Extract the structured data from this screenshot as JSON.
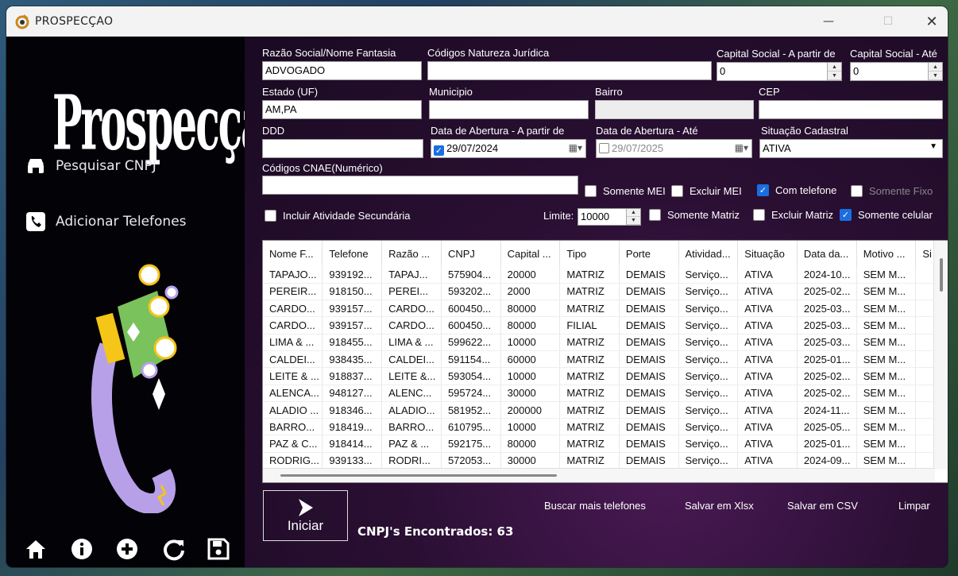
{
  "window": {
    "title": "PROSPECÇAO"
  },
  "sidebar": {
    "logo": "Prospecçao",
    "nav": [
      {
        "label": "Pesquisar CNPJ",
        "icon": "store-icon"
      },
      {
        "label": "Adicionar Telefones",
        "icon": "phone-icon"
      }
    ],
    "bottom_icons": [
      "home-icon",
      "info-icon",
      "add-icon",
      "refresh-icon",
      "save-icon"
    ]
  },
  "form": {
    "razao_label": "Razão Social/Nome Fantasia",
    "razao_value": "ADVOGADO",
    "natureza_label": "Códigos Natureza Jurídica",
    "natureza_value": "",
    "capital_de_label": "Capital Social - A partir de",
    "capital_de_value": "0",
    "capital_ate_label": "Capital Social - Até",
    "capital_ate_value": "0",
    "estado_label": "Estado (UF)",
    "estado_value": "AM,PA",
    "municipio_label": "Municipio",
    "municipio_value": "",
    "bairro_label": "Bairro",
    "bairro_value": "",
    "cep_label": "CEP",
    "cep_value": "",
    "ddd_label": "DDD",
    "ddd_value": "",
    "abertura_de_label": "Data de Abertura - A partir de",
    "abertura_de_value": "29/07/2024",
    "abertura_ate_label": "Data de Abertura - Até",
    "abertura_ate_value": "29/07/2025",
    "situacao_label": "Situação Cadastral",
    "situacao_value": "ATIVA",
    "cnae_label": "Códigos CNAE(Numérico)",
    "cnae_value": "",
    "somente_mei": "Somente MEI",
    "excluir_mei": "Excluir MEI",
    "com_telefone": "Com telefone",
    "somente_fixo": "Somente Fixo",
    "incluir_secundaria": "Incluir Atividade Secundária",
    "limite_label": "Limite:",
    "limite_value": "10000",
    "somente_matriz": "Somente Matriz",
    "excluir_matriz": "Excluir Matriz",
    "somente_celular": "Somente celular"
  },
  "table": {
    "columns": [
      "Nome F...",
      "Telefone",
      "Razão ...",
      "CNPJ",
      "Capital ...",
      "Tipo",
      "Porte",
      "Atividad...",
      "Situação",
      "Data da...",
      "Motivo ...",
      "Si"
    ],
    "rows": [
      [
        "TAPAJO...",
        "939192...",
        "TAPAJ...",
        "575904...",
        "20000",
        "MATRIZ",
        "DEMAIS",
        "Serviço...",
        "ATIVA",
        "2024-10...",
        "SEM M...",
        ""
      ],
      [
        "PEREIR...",
        "918150...",
        "PEREI...",
        "593202...",
        "2000",
        "MATRIZ",
        "DEMAIS",
        "Serviço...",
        "ATIVA",
        "2025-02...",
        "SEM M...",
        ""
      ],
      [
        "CARDO...",
        "939157...",
        "CARDO...",
        "600450...",
        "80000",
        "MATRIZ",
        "DEMAIS",
        "Serviço...",
        "ATIVA",
        "2025-03...",
        "SEM M...",
        ""
      ],
      [
        "CARDO...",
        "939157...",
        "CARDO...",
        "600450...",
        "80000",
        "FILIAL",
        "DEMAIS",
        "Serviço...",
        "ATIVA",
        "2025-03...",
        "SEM M...",
        ""
      ],
      [
        "LIMA & ...",
        "918455...",
        "LIMA & ...",
        "599622...",
        "10000",
        "MATRIZ",
        "DEMAIS",
        "Serviço...",
        "ATIVA",
        "2025-03...",
        "SEM M...",
        ""
      ],
      [
        "CALDEI...",
        "938435...",
        "CALDEI...",
        "591154...",
        "60000",
        "MATRIZ",
        "DEMAIS",
        "Serviço...",
        "ATIVA",
        "2025-01...",
        "SEM M...",
        ""
      ],
      [
        "LEITE & ...",
        "918837...",
        "LEITE &...",
        "593054...",
        "10000",
        "MATRIZ",
        "DEMAIS",
        "Serviço...",
        "ATIVA",
        "2025-02...",
        "SEM M...",
        ""
      ],
      [
        "ALENCA...",
        "948127...",
        "ALENC...",
        "595724...",
        "30000",
        "MATRIZ",
        "DEMAIS",
        "Serviço...",
        "ATIVA",
        "2025-02...",
        "SEM M...",
        ""
      ],
      [
        "ALADIO ...",
        "918346...",
        "ALADIO...",
        "581952...",
        "200000",
        "MATRIZ",
        "DEMAIS",
        "Serviço...",
        "ATIVA",
        "2024-11...",
        "SEM M...",
        ""
      ],
      [
        "BARRO...",
        "918419...",
        "BARRO...",
        "610795...",
        "10000",
        "MATRIZ",
        "DEMAIS",
        "Serviço...",
        "ATIVA",
        "2025-05...",
        "SEM M...",
        ""
      ],
      [
        "PAZ & C...",
        "918414...",
        "PAZ & ...",
        "592175...",
        "80000",
        "MATRIZ",
        "DEMAIS",
        "Serviço...",
        "ATIVA",
        "2025-01...",
        "SEM M...",
        ""
      ],
      [
        "RODRIG...",
        "939133...",
        "RODRI...",
        "572053...",
        "30000",
        "MATRIZ",
        "DEMAIS",
        "Serviço...",
        "ATIVA",
        "2024-09...",
        "SEM M...",
        ""
      ]
    ]
  },
  "actions": {
    "iniciar": "Iniciar",
    "buscar": "Buscar mais telefones",
    "xlsx": "Salvar em Xlsx",
    "csv": "Salvar em CSV",
    "limpar": "Limpar",
    "found": "CNPJ's Encontrados: 63"
  },
  "colors": {
    "accent": "#1a6ee0",
    "sidebar_bg": "#030206",
    "main_bg": "#2a0f33"
  }
}
